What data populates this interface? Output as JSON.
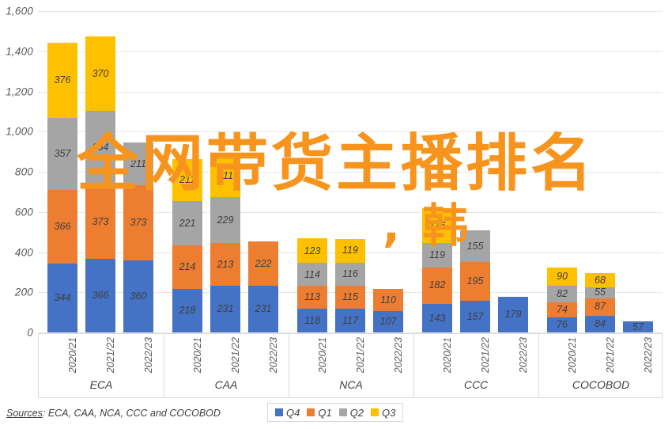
{
  "chart_data": {
    "type": "bar",
    "subtype": "stacked-grouped-column",
    "title": "",
    "xlabel": "",
    "ylabel": "",
    "ylim": [
      0,
      1600
    ],
    "ytick_step": 200,
    "ytick_labels": [
      "0",
      "200",
      "400",
      "600",
      "800",
      "1,000",
      "1,200",
      "1,400",
      "1,600"
    ],
    "grid": true,
    "legend_position": "bottom",
    "series_order": [
      "Q4",
      "Q1",
      "Q2",
      "Q3"
    ],
    "series_colors": {
      "Q4": "#4472c4",
      "Q1": "#ed7d31",
      "Q2": "#a5a5a5",
      "Q3": "#ffc000"
    },
    "groups": [
      "ECA",
      "CAA",
      "NCA",
      "CCC",
      "COCOBOD"
    ],
    "categories": [
      "2020/21",
      "2021/22",
      "2022/23"
    ],
    "data": [
      {
        "group": "ECA",
        "bars": [
          {
            "category": "2020/21",
            "Q4": 344,
            "Q1": 366,
            "Q2": 357,
            "Q3": 376
          },
          {
            "category": "2021/22",
            "Q4": 366,
            "Q1": 373,
            "Q2": 364,
            "Q3": 370
          },
          {
            "category": "2022/23",
            "Q4": 360,
            "Q1": 373,
            "Q2": 211,
            "Q3": 0
          }
        ]
      },
      {
        "group": "CAA",
        "bars": [
          {
            "category": "2020/21",
            "Q4": 218,
            "Q1": 214,
            "Q2": 221,
            "Q3": 211
          },
          {
            "category": "2021/22",
            "Q4": 231,
            "Q1": 213,
            "Q2": 229,
            "Q3": 211
          },
          {
            "category": "2022/23",
            "Q4": 231,
            "Q1": 222,
            "Q2": 0,
            "Q3": 0
          }
        ]
      },
      {
        "group": "NCA",
        "bars": [
          {
            "category": "2020/21",
            "Q4": 118,
            "Q1": 113,
            "Q2": 114,
            "Q3": 123
          },
          {
            "category": "2021/22",
            "Q4": 117,
            "Q1": 115,
            "Q2": 116,
            "Q3": 119
          },
          {
            "category": "2022/23",
            "Q4": 107,
            "Q1": 110,
            "Q2": 0,
            "Q3": 0
          }
        ]
      },
      {
        "group": "CCC",
        "bars": [
          {
            "category": "2020/21",
            "Q4": 143,
            "Q1": 182,
            "Q2": 119,
            "Q3": 176
          },
          {
            "category": "2021/22",
            "Q4": 157,
            "Q1": 195,
            "Q2": 155,
            "Q3": 0
          },
          {
            "category": "2022/23",
            "Q4": 179,
            "Q1": 0,
            "Q2": 0,
            "Q3": 0
          }
        ]
      },
      {
        "group": "COCOBOD",
        "bars": [
          {
            "category": "2020/21",
            "Q4": 76,
            "Q1": 74,
            "Q2": 82,
            "Q3": 90
          },
          {
            "category": "2021/22",
            "Q4": 84,
            "Q1": 87,
            "Q2": 55,
            "Q3": 68
          },
          {
            "category": "2022/23",
            "Q4": 57,
            "Q1": 0,
            "Q2": 0,
            "Q3": 0
          }
        ]
      }
    ],
    "legend": [
      {
        "label": "Q4",
        "color": "#4472c4"
      },
      {
        "label": "Q1",
        "color": "#ed7d31"
      },
      {
        "label": "Q2",
        "color": "#a5a5a5"
      },
      {
        "label": "Q3",
        "color": "#ffc000"
      }
    ]
  },
  "source": {
    "label": "Sources",
    "separator": ": ",
    "text": "ECA, CAA, NCA, CCC and COCOBOD"
  },
  "watermark": {
    "line1": "全网带货主播排名",
    "line2": ", 韩",
    "color": "#f7941d"
  }
}
